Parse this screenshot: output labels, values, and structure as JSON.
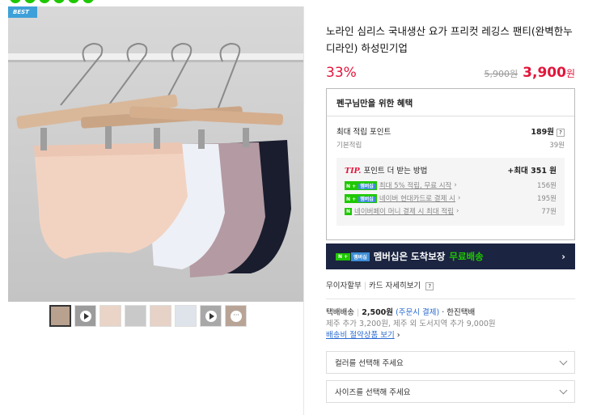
{
  "badge": "BEST",
  "product": {
    "title": "노라인 심리스 국내생산 요가 프리컷 레깅스 팬티(완벽한누디라인) 하성민기업",
    "discount": "33%",
    "original_price": "5,900원",
    "sale_price": "3,900",
    "sale_unit": "원"
  },
  "benefit": {
    "header": "펜구님만을 위한 혜택",
    "max_points_label": "최대 적립 포인트",
    "max_points_value": "189원",
    "help": "?",
    "basic_label": "기본적립",
    "basic_value": "39원",
    "tip_label": "TIP.",
    "tip_text": "포인트 더 받는 방법",
    "tip_max": "+최대 351 원",
    "tips": [
      {
        "text": "최대 5% 적립, 무료 시작",
        "value": "156원"
      },
      {
        "text": "네이버 현대카드로 결제 시",
        "value": "195원"
      },
      {
        "text": "네이버페이 머니 결제 시 최대 적립",
        "value": "77원"
      }
    ],
    "badge_n": "N",
    "badge_plus": "+",
    "badge_membership": "멤버십"
  },
  "membership_bar": {
    "text": "멤버십은 도착보장",
    "free": "무료배송",
    "arrow": "›"
  },
  "installment": {
    "text": "무이자할부",
    "sep": "|",
    "card_link": "카드 자세히보기",
    "help": "?"
  },
  "shipping": {
    "label": "택배배송",
    "fee": "2,500원",
    "condition": "(주문시 결제)",
    "carrier": "· 한진택배",
    "extra": "제주 추가 3,200원, 제주 외 도서지역 추가 9,000원",
    "link": "배송비 절약상품 보기",
    "link_arrow": "›"
  },
  "selects": {
    "color_placeholder": "컬러를 선택해 주세요",
    "size_placeholder": "사이즈를 선택해 주세요"
  },
  "colors": {
    "accent_red": "#e3153b",
    "naver_green": "#1ec800",
    "member_bar_bg": "#1b2440",
    "badge_blue": "#3ea0d8"
  }
}
